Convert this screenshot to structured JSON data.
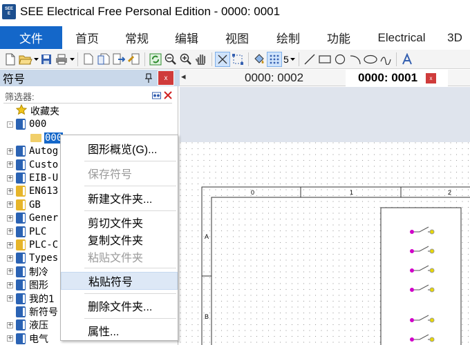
{
  "window": {
    "title": "SEE Electrical Free Personal Edition - 0000: 0001",
    "icon_text_top": "SEE",
    "icon_text_bottom": "E"
  },
  "menu": {
    "tabs": [
      "文件",
      "首页",
      "常规",
      "编辑",
      "视图",
      "绘制",
      "功能",
      "Electrical",
      "3D"
    ],
    "active_index": 0
  },
  "toolbar": {
    "icons": [
      "new-icon",
      "open-icon",
      "save-icon",
      "print-icon",
      "page-icon",
      "pages-icon",
      "export-icon",
      "import-icon",
      "refresh-icon",
      "zoom-out-icon",
      "zoom-in-icon",
      "pan-hand-icon",
      "select-icon",
      "select-area-icon",
      "paint-icon",
      "grid-icon",
      "line-icon",
      "rectangle-icon",
      "circle-icon",
      "arc-icon",
      "ellipse-icon",
      "curve-icon",
      "text-icon"
    ],
    "grid_value": "5"
  },
  "symbol_panel": {
    "title": "符号",
    "pin": "▐",
    "close": "x",
    "filter_placeholder": "筛选器:",
    "tree": [
      {
        "label": "收藏夹",
        "type": "favorites",
        "expander": "",
        "indent": 0
      },
      {
        "label": "000",
        "type": "book",
        "expander": "-",
        "indent": 0
      },
      {
        "label": "000",
        "type": "folder",
        "expander": "",
        "indent": 1,
        "selected": true
      },
      {
        "label": "Autog",
        "type": "book",
        "expander": "+",
        "indent": 0
      },
      {
        "label": "Custo",
        "type": "book",
        "expander": "+",
        "indent": 0
      },
      {
        "label": "EIB-U",
        "type": "book",
        "expander": "+",
        "indent": 0
      },
      {
        "label": "EN613",
        "type": "book-yellow",
        "expander": "+",
        "indent": 0
      },
      {
        "label": "GB",
        "type": "book-yellow",
        "expander": "+",
        "indent": 0
      },
      {
        "label": "Gener",
        "type": "book",
        "expander": "+",
        "indent": 0
      },
      {
        "label": "PLC",
        "type": "book",
        "expander": "+",
        "indent": 0
      },
      {
        "label": "PLC-C",
        "type": "book-yellow",
        "expander": "+",
        "indent": 0
      },
      {
        "label": "Types",
        "type": "book",
        "expander": "+",
        "indent": 0
      },
      {
        "label": "制冷",
        "type": "book",
        "expander": "+",
        "indent": 0
      },
      {
        "label": "图形",
        "type": "book",
        "expander": "+",
        "indent": 0
      },
      {
        "label": "我的1",
        "type": "book",
        "expander": "+",
        "indent": 0
      },
      {
        "label": "新符号",
        "type": "book",
        "expander": "",
        "indent": 0
      },
      {
        "label": "液压",
        "type": "book",
        "expander": "+",
        "indent": 0
      },
      {
        "label": "电气",
        "type": "book",
        "expander": "+",
        "indent": 0
      }
    ]
  },
  "context_menu": {
    "items": [
      {
        "label": "图形概览(G)...",
        "disabled": false
      },
      {
        "label": "保存符号",
        "disabled": true
      },
      {
        "label": "新建文件夹...",
        "disabled": false
      },
      {
        "label": "剪切文件夹",
        "disabled": false
      },
      {
        "label": "复制文件夹",
        "disabled": false
      },
      {
        "label": "粘贴文件夹",
        "disabled": true
      },
      {
        "label": "粘贴符号",
        "disabled": false,
        "hovered": true
      },
      {
        "label": "删除文件夹...",
        "disabled": false
      },
      {
        "label": "属性...",
        "disabled": false
      }
    ]
  },
  "doc_tabs": {
    "nav_arrow": "◂",
    "tabs": [
      {
        "label": "0000: 0002",
        "active": false
      },
      {
        "label": "0000: 0001",
        "active": true
      }
    ],
    "close": "x"
  },
  "drawing": {
    "column_labels": [
      "0",
      "1",
      "2"
    ],
    "row_labels": [
      "A",
      "B"
    ],
    "colors": {
      "contact_left": "#d000c8",
      "contact_right": "#e8d800",
      "canvas_header": "#dfe4ed"
    }
  }
}
